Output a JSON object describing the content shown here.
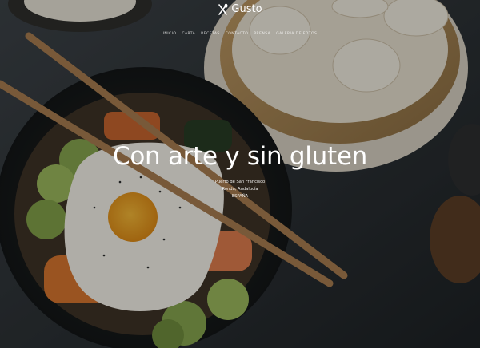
{
  "brand": {
    "name": "Gusto",
    "icon": "fork-knife-icon"
  },
  "nav": {
    "items": [
      {
        "label": "INICIO"
      },
      {
        "label": "CARTA"
      },
      {
        "label": "RECETAS"
      },
      {
        "label": "CONTACTO"
      },
      {
        "label": "PRENSA"
      },
      {
        "label": "GALERIA DE FOTOS"
      }
    ]
  },
  "hero": {
    "title": "Con arte y sin gluten",
    "address": {
      "line1": "Puerto de San Francisco",
      "line2": "Ronda, Andalucía",
      "line3": "ESPAÑA"
    }
  },
  "colors": {
    "text": "#ffffff",
    "background": "#1c1f22"
  }
}
